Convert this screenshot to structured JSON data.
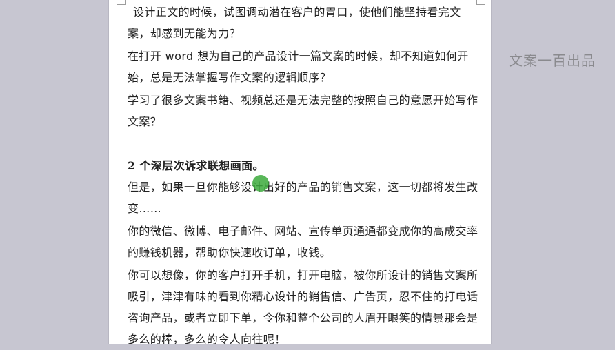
{
  "watermark": "文案一百出品",
  "paragraphs": {
    "p1": "设计正文的时候，试图调动潜在客户的胃口，使他们能坚持看完文案，却感到无能为力？",
    "p2": "在打开 word 想为自己的产品设计一篇文案的时候，却不知道如何开始，总是无法掌握写作文案的逻辑顺序？",
    "p3": "学习了很多文案书籍、视频总还是无法完整的按照自己的意愿开始写作文案？",
    "heading": "2 个深层次诉求联想画面。",
    "p4": "但是，如果一旦你能够设计出好的产品的销售文案，这一切都将发生改变……",
    "p5": "你的微信、微博、电子邮件、网站、宣传单页通通都变成你的高成交率的赚钱机器，帮助你快速收订单，收钱。",
    "p6": "你可以想像，你的客户打开手机，打开电脑，被你所设计的销售文案所吸引，津津有味的看到你精心设计的销售信、广告页，忍不住的打电话咨询产品，或者立即下单，令你和整个公司的人眉开眼笑的情景那会是多么的棒，多么的令人向往呢！"
  },
  "colors": {
    "background": "#c7c6d1",
    "page": "#ffffff",
    "cursor_highlight": "#3caa3c"
  }
}
